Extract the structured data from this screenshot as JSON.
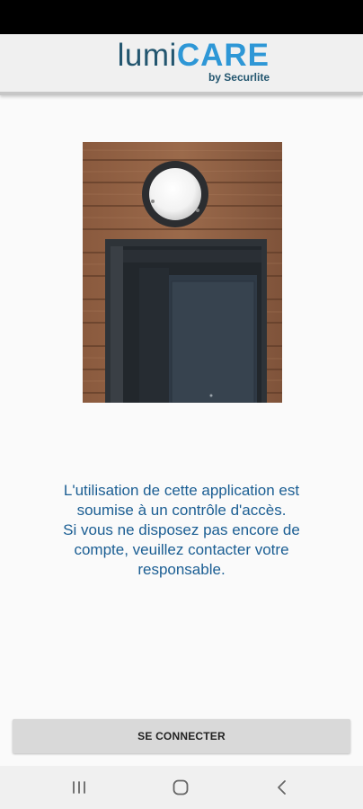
{
  "app": {
    "logo_text_lumi": "lumi",
    "logo_text_care": "CARE",
    "logo_byline": "by Securlite"
  },
  "main": {
    "message_lines": [
      "L'utilisation de cette application est",
      "soumise à un contrôle d'accès.",
      "Si vous ne disposez pas encore de",
      "compte, veuillez contacter votre",
      "responsable."
    ],
    "login_button_label": "SE CONNECTER"
  },
  "colors": {
    "logo_dark": "#23566f",
    "logo_light": "#2e97d6",
    "message_text": "#1b5e93",
    "button_bg": "#d9d9d9"
  },
  "navbar": {
    "icons": [
      "recent-apps-icon",
      "home-icon",
      "back-icon"
    ]
  }
}
